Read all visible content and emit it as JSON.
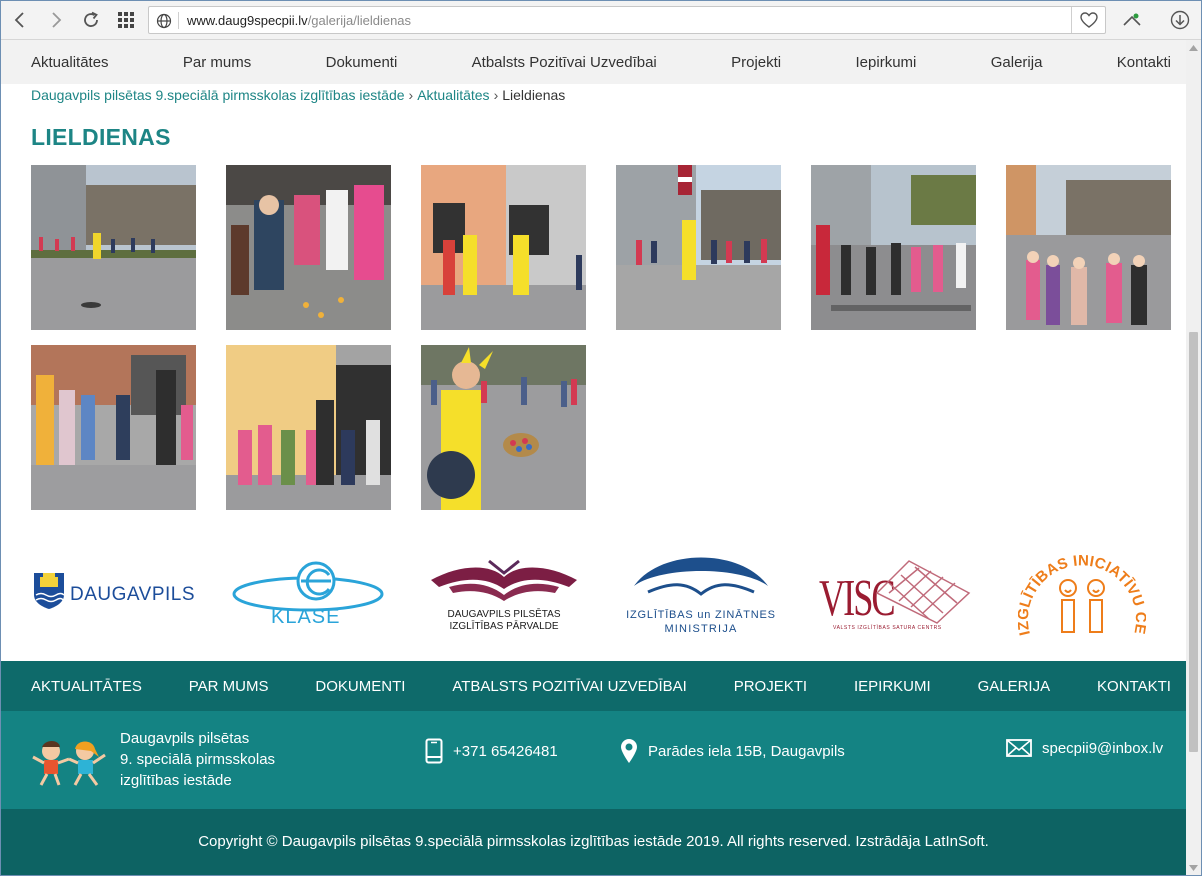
{
  "browser": {
    "url_host": "www.daug9specpii.lv",
    "url_path": "/galerija/lieldienas",
    "icons": [
      "back-arrow-icon",
      "forward-arrow-icon",
      "reload-icon",
      "speed-dial-grid-icon",
      "globe-icon",
      "heart-icon",
      "vpn-icon",
      "download-icon"
    ]
  },
  "topnav": {
    "items": [
      "Aktualitātes",
      "Par mums",
      "Dokumenti",
      "Atbalsts Pozitīvai Uzvedībai",
      "Projekti",
      "Iepirkumi",
      "Galerija",
      "Kontakti"
    ]
  },
  "breadcrumb": {
    "home": "Daugavpils pilsētas 9.speciālā pirmsskolas izglītības iestāde",
    "section": "Aktualitātes",
    "separator": "›",
    "current": "Lieldienas"
  },
  "page": {
    "title": "LIELDIENAS"
  },
  "gallery": {
    "photo_count": 9
  },
  "partners": {
    "daugavpils": "DAUGAVPILS",
    "klase": "KLASE",
    "parvalde": [
      "DAUGAVPILS PILSĒTAS",
      "IZGLĪTĪBAS PĀRVALDE"
    ],
    "ministrija": [
      "IZGLĪTĪBAS un ZINĀTNES",
      "MINISTRIJA"
    ],
    "visc": "VISC",
    "visc_sub": "VALSTS IZGLĪTĪBAS SATURA CENTRS",
    "iniciativu": "IZGLĪTĪBAS INICIATĪVU CENTRS"
  },
  "footnav": {
    "items": [
      "AKTUALITĀTES",
      "PAR MUMS",
      "DOKUMENTI",
      "ATBALSTS POZITĪVAI UZVEDĪBAI",
      "PROJEKTI",
      "IEPIRKUMI",
      "GALERIJA",
      "KONTAKTI"
    ]
  },
  "footer": {
    "school_lines": [
      "Daugavpils pilsētas",
      "9. speciālā pirmsskolas",
      "izglītības iestāde"
    ],
    "phone": "+371 65426481",
    "address": "Parādes iela 15B, Daugavpils",
    "email": "specpii9@inbox.lv",
    "copyright": "Copyright © Daugavpils pilsētas 9.speciālā pirmsskolas izglītības iestāde 2019. All rights reserved. Izstrādāja LatInSoft."
  },
  "colors": {
    "teal_text": "#1d8585",
    "footnav_bg": "#0e6a6a",
    "footinfo_bg": "#148383",
    "copyright_bg": "#0d6363"
  }
}
